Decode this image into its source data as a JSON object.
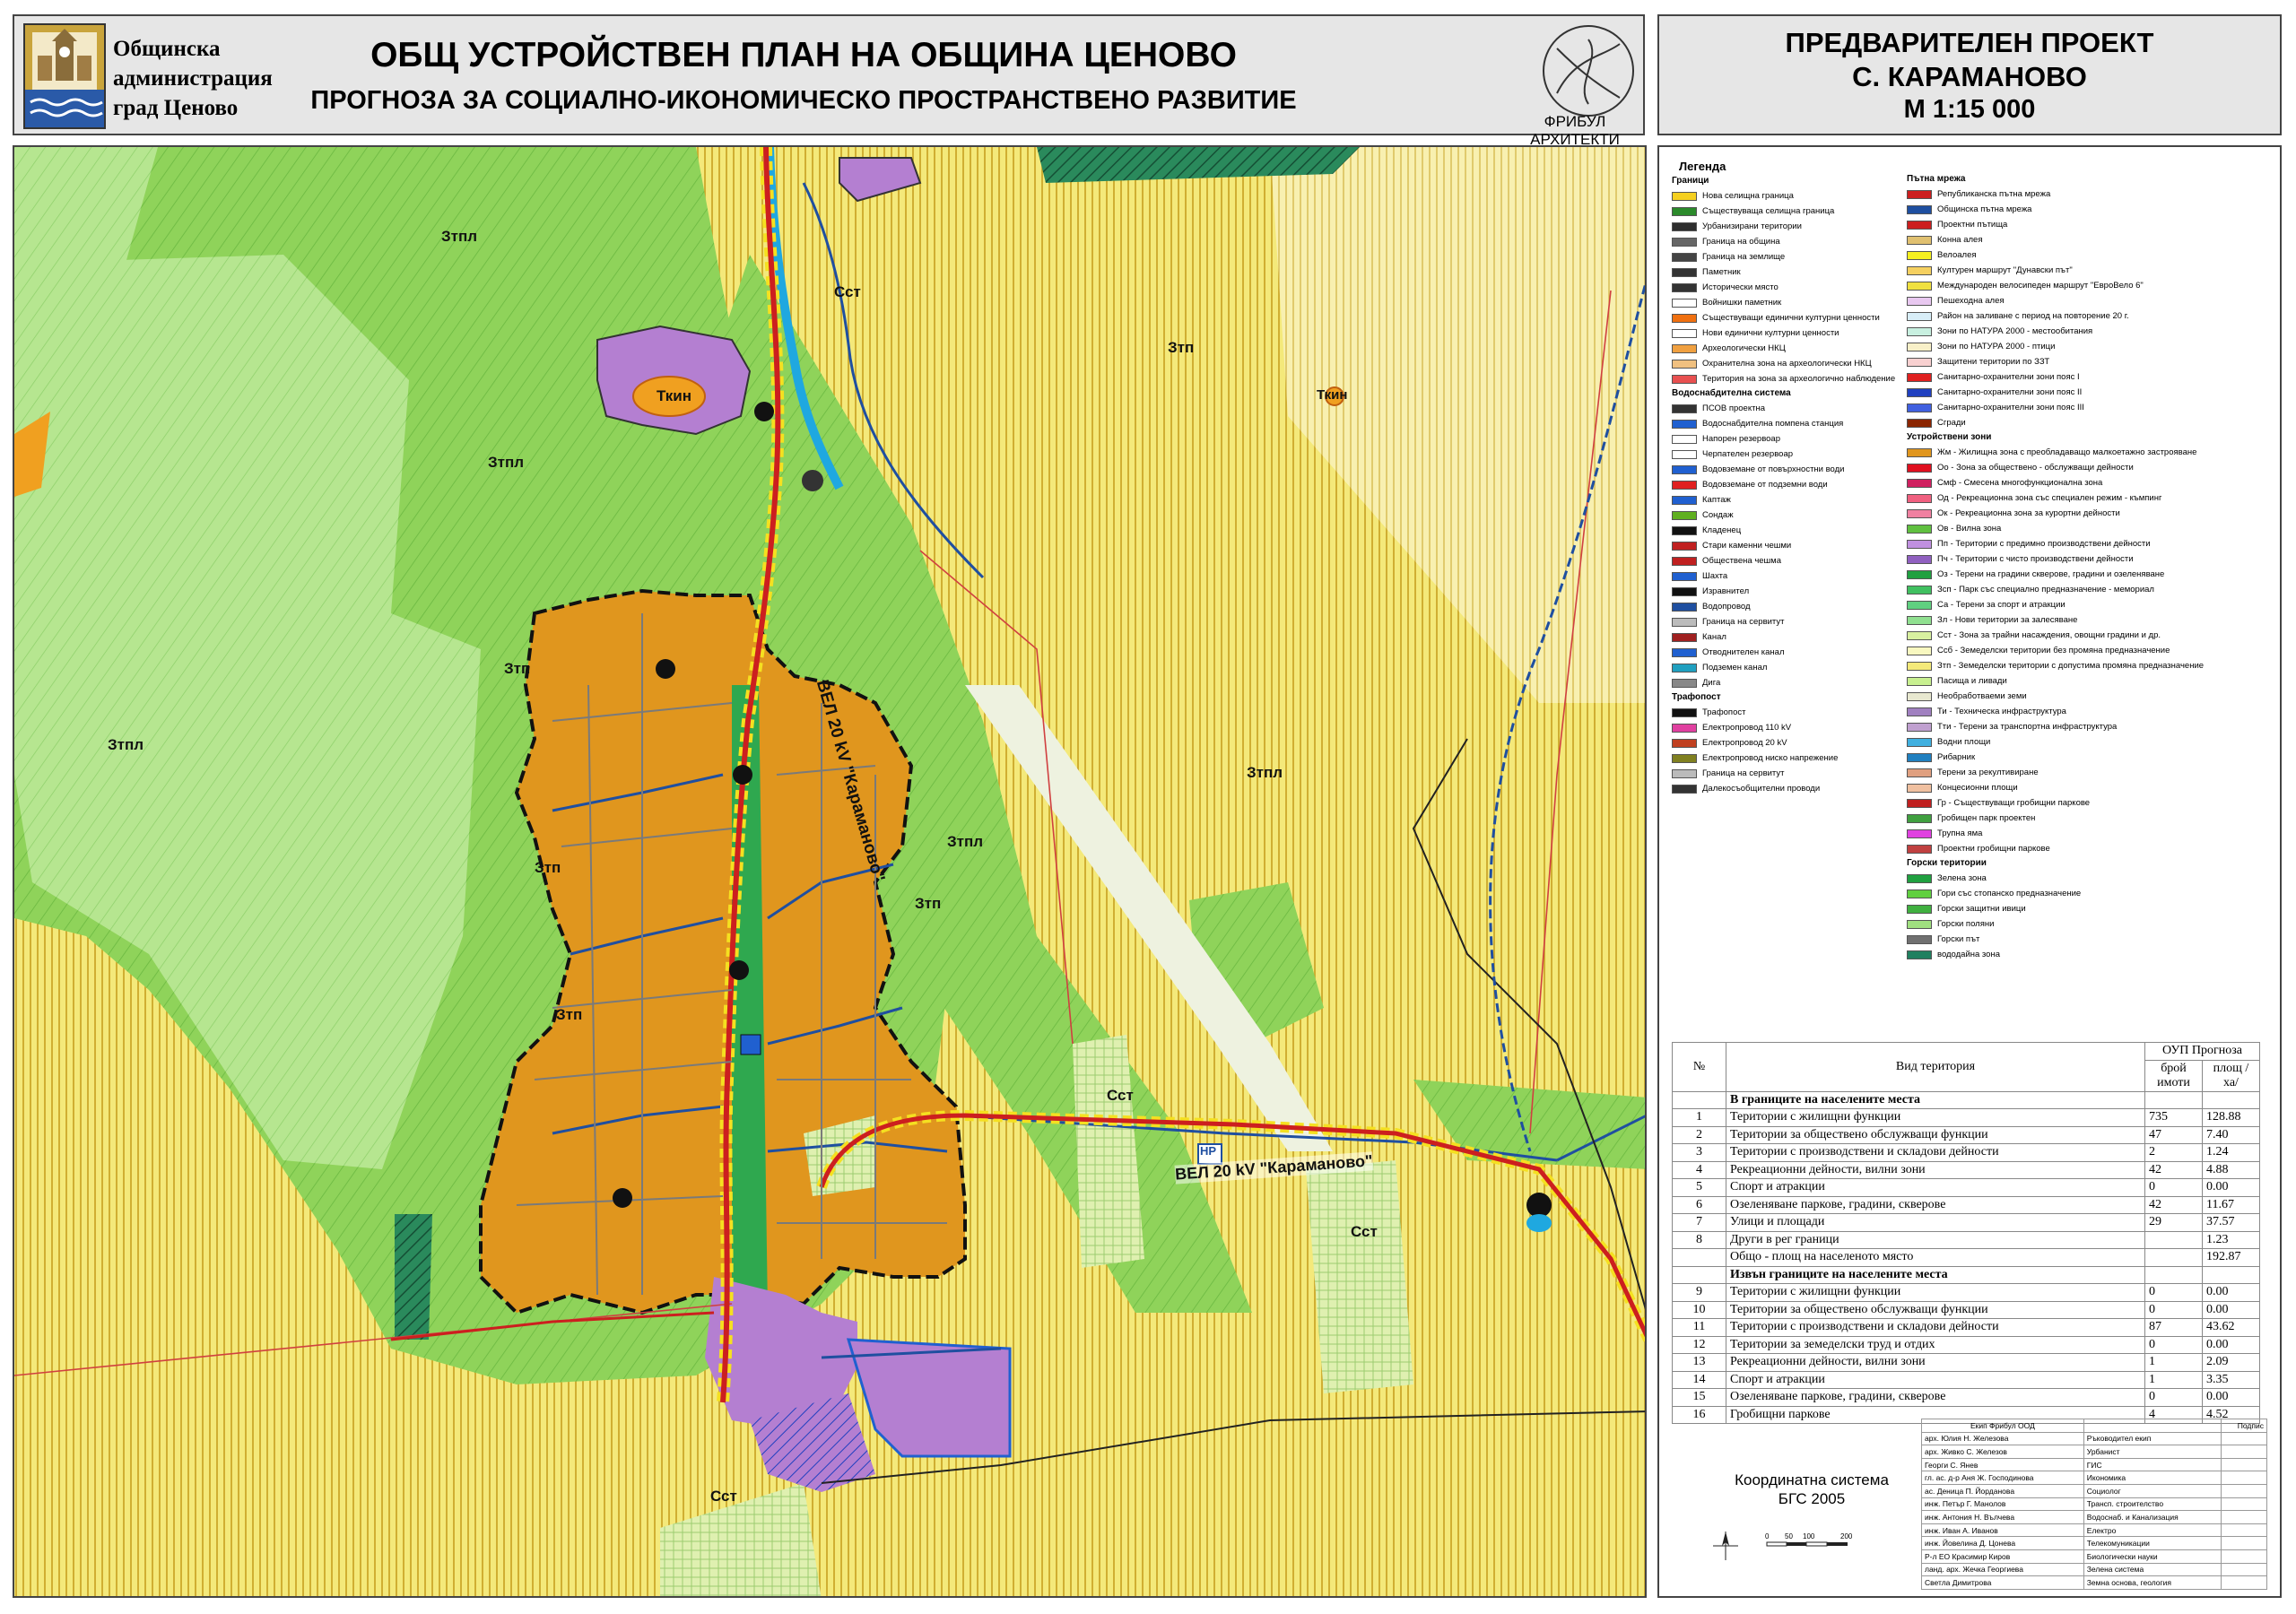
{
  "header": {
    "municipality": [
      "Общинска",
      "администрация",
      "град Ценово"
    ],
    "title_line1": "ОБЩ УСТРОЙСТВЕН ПЛАН НА ОБЩИНА ЦЕНОВО",
    "title_line2": "ПРОГНОЗА ЗА СОЦИАЛНО-ИКОНОМИЧЕСКО ПРОСТРАНСТВЕНО РАЗВИТИЕ",
    "firm": "ФРИБУЛ АРХИТЕКТИ"
  },
  "project": {
    "line1": "ПРЕДВАРИТЕЛЕН ПРОЕКТ",
    "line2": "С. КАРАМАНОВО",
    "line3": "М 1:15 000"
  },
  "colors": {
    "housing": "#e0961e",
    "agri": "#f4e97a",
    "forest_light": "#8fd35a",
    "forest": "#76c648",
    "pasture": "#b6e690",
    "industry": "#b47fd1",
    "road_rep": "#cc1f1f",
    "water": "#1fa8e0",
    "blue_net": "#1f4fa0"
  },
  "map_labels": {
    "ztpl_1": "Зтпл",
    "ztpl_2": "Зтпл",
    "ztpl_3": "Зтпл",
    "ztpl_4": "Зтпл",
    "ztpl_5": "Зтпл",
    "ztp_1": "Зтп",
    "ztp_2": "Зтп",
    "ztp_3": "Зтп",
    "ztp_4": "Зтп",
    "ztp_5": "Зтп",
    "sst_1": "Сст",
    "sst_2": "Сст",
    "sst_3": "Сст",
    "sst_4": "Сст",
    "tkin_1": "Ткин",
    "tkin_2": "Ткин",
    "line_label": "ВЕЛ 20 kV \"Караманово\"",
    "nr": "НР"
  },
  "legend": {
    "title": "Легенда",
    "col1": [
      {
        "sec": "Граници"
      },
      {
        "label": "Нова селищна граница",
        "color": "#f5d020"
      },
      {
        "label": "Съществуваща селищна граница",
        "color": "#2b8a2b"
      },
      {
        "label": "Урбанизирани територии",
        "color": "#2e2e2e"
      },
      {
        "label": "Граница на община",
        "color": "#666666"
      },
      {
        "label": "Граница на землище",
        "color": "#444444"
      },
      {
        "label": "Паметник",
        "color": "#333333"
      },
      {
        "label": "Исторически място",
        "color": "#333333"
      },
      {
        "label": "Войнишки паметник",
        "color": "#ffffff"
      },
      {
        "label": "Съществуващи единични културни ценности",
        "color": "#f07010"
      },
      {
        "label": "Нови единични културни ценности",
        "color": "#ffffff"
      },
      {
        "label": "Археологически НКЦ",
        "color": "#f0a040"
      },
      {
        "label": "Охранителна зона на археологически НКЦ",
        "color": "#f0c080"
      },
      {
        "label": "Територия на зона за археологично наблюдение",
        "color": "#e85050"
      },
      {
        "sec": "Водоснабдителна система"
      },
      {
        "label": "ПСОВ проектна",
        "color": "#333333"
      },
      {
        "label": "Водоснабдителна помпена станция",
        "color": "#2060d0"
      },
      {
        "label": "Напорен резервоар",
        "color": "#ffffff"
      },
      {
        "label": "Черпателен резервоар",
        "color": "#ffffff"
      },
      {
        "label": "Водовземане от повърхностни води",
        "color": "#2060d0"
      },
      {
        "label": "Водовземане от подземни води",
        "color": "#e02020"
      },
      {
        "label": "Каптаж",
        "color": "#2060d0"
      },
      {
        "label": "Сондаж",
        "color": "#60b020"
      },
      {
        "label": "Кладенец",
        "color": "#111111"
      },
      {
        "label": "Стари каменни чешми",
        "color": "#c02020"
      },
      {
        "label": "Обществена чешма",
        "color": "#c02020"
      },
      {
        "label": "Шахта",
        "color": "#2060d0"
      },
      {
        "label": "Изравнител",
        "color": "#111111"
      },
      {
        "label": "Водопровод",
        "color": "#1f4fa0"
      },
      {
        "label": "Граница на сервитут",
        "color": "#bbbbbb"
      },
      {
        "label": "Канал",
        "color": "#a02020"
      },
      {
        "label": "Отводнителен канал",
        "color": "#2060d0"
      },
      {
        "label": "Подземен канал",
        "color": "#20a0c0"
      },
      {
        "label": "Дига",
        "color": "#888888"
      },
      {
        "sec": "Трафопост"
      },
      {
        "label": "Трафопост",
        "color": "#111111"
      },
      {
        "label": "Електропровод 110 kV",
        "color": "#e040a0"
      },
      {
        "label": "Електропровод 20 kV",
        "color": "#c04020"
      },
      {
        "label": "Електропровод ниско напрежение",
        "color": "#808020"
      },
      {
        "label": "Граница на сервитут",
        "color": "#bbbbbb"
      },
      {
        "label": "Далекосъобщителни проводи",
        "color": "#333333"
      }
    ],
    "col2": [
      {
        "sec": "Пътна мрежа"
      },
      {
        "label": "Републиканска пътна мрежа",
        "color": "#cc1f1f"
      },
      {
        "label": "Общинска пътна мрежа",
        "color": "#1f4fa0"
      },
      {
        "label": "Проектни пътища",
        "color": "#cc1f1f"
      },
      {
        "label": "Конна алея",
        "color": "#e0c070"
      },
      {
        "label": "Велоалея",
        "color": "#f5f020"
      },
      {
        "label": "Културен маршрут \"Дунавски път\"",
        "color": "#f5d060"
      },
      {
        "label": "Международен велосипеден маршрут \"ЕвроВело 6\"",
        "color": "#f0e040"
      },
      {
        "label": "Пешеходна алея",
        "color": "#e8c8f0"
      },
      {
        "label": "Район на заливане с период на повторение 20 г.",
        "color": "#d8eef8"
      },
      {
        "label": "Зони по НАТУРА 2000 - местообитания",
        "color": "#c8f0e0"
      },
      {
        "label": "Зони по НАТУРА 2000 - птици",
        "color": "#f8f0c8"
      },
      {
        "label": "Защитени територии по ЗЗТ",
        "color": "#f8d0d0"
      },
      {
        "label": "Санитарно-охранителни зони пояс I",
        "color": "#e02020"
      },
      {
        "label": "Санитарно-охранителни зони пояс II",
        "color": "#2040c0"
      },
      {
        "label": "Санитарно-охранителни зони пояс III",
        "color": "#4060e0"
      },
      {
        "label": "Сгради",
        "color": "#8b2500"
      },
      {
        "sec": "Устройствени зони"
      },
      {
        "label": "Жм - Жилищна зона с преобладаващо малкоетажно застрояване",
        "color": "#e0961e"
      },
      {
        "label": "Оо - Зона за обществено - обслужващи дейности",
        "color": "#e01020"
      },
      {
        "label": "Смф - Смесена многофункционална зона",
        "color": "#d02060"
      },
      {
        "label": "Од - Рекреационна зона със специален режим - къмпинг",
        "color": "#f06080"
      },
      {
        "label": "Ок - Рекреационна зона за курортни дейности",
        "color": "#f080a0"
      },
      {
        "label": "Ов - Вилна зона",
        "color": "#60c040"
      },
      {
        "label": "Пп - Територии с предимно производствени дейности",
        "color": "#c090e0"
      },
      {
        "label": "Пч - Територии с чисто производствени дейности",
        "color": "#9060c0"
      },
      {
        "label": "Оз - Терени на градини скверове, градини и озеленяване",
        "color": "#20a040"
      },
      {
        "label": "Зсп - Парк със специално предназначение - мемориал",
        "color": "#40c060"
      },
      {
        "label": "Са - Терени за спорт и атракции",
        "color": "#60d080"
      },
      {
        "label": "Зл - Нови територии за залесяване",
        "color": "#90e090"
      },
      {
        "label": "Сст - Зона за трайни насаждения, овощни градини и др.",
        "color": "#d8f0a0"
      },
      {
        "label": "Ссб - Земеделски територии без промяна предназначение",
        "color": "#f8f8c0"
      },
      {
        "label": "Зтп - Земеделски територии с допустима промяна предназначение",
        "color": "#f4e97a"
      },
      {
        "label": "Пасища и ливади",
        "color": "#c8f090"
      },
      {
        "label": "Необработваеми земи",
        "color": "#e8e8d0"
      },
      {
        "label": "Ти - Техническа инфраструктура",
        "color": "#a080c0"
      },
      {
        "label": "Тти - Терени за транспортна инфраструктура",
        "color": "#c0a0d0"
      },
      {
        "label": "Водни площи",
        "color": "#40b0e0"
      },
      {
        "label": "Рибарник",
        "color": "#2080c0"
      },
      {
        "label": "Терени за рекултивиране",
        "color": "#e0a080"
      },
      {
        "label": "Концесионни площи",
        "color": "#f0c0a0"
      },
      {
        "label": "Гр - Съществуващи гробищни паркове",
        "color": "#c02020"
      },
      {
        "label": "Гробищен парк проектен",
        "color": "#40a040"
      },
      {
        "label": "Трупна яма",
        "color": "#e040e0"
      },
      {
        "label": "Проектни гробищни паркове",
        "color": "#c04040"
      },
      {
        "sec": "Горски територии"
      },
      {
        "label": "Зелена зона",
        "color": "#20a040"
      },
      {
        "label": "Гори със стопанско предназначение",
        "color": "#60d040"
      },
      {
        "label": "Горски защитни ивици",
        "color": "#40b040"
      },
      {
        "label": "Горски поляни",
        "color": "#a0e080"
      },
      {
        "label": "Горски път",
        "color": "#707070"
      },
      {
        "label": "вододайна зона",
        "color": "#208060"
      }
    ]
  },
  "area_table": {
    "headers": {
      "no": "№",
      "type": "Вид територия",
      "group": "ОУП Прогноза",
      "count": "брой имоти",
      "area": "площ /ха/"
    },
    "section1": "В границите на населените места",
    "rows1": [
      {
        "no": "1",
        "name": "Територии с жилищни функции",
        "count": "735",
        "area": "128.88"
      },
      {
        "no": "2",
        "name": "Територии за обществено обслужващи функции",
        "count": "47",
        "area": "7.40"
      },
      {
        "no": "3",
        "name": "Територии с производствени и складови дейности",
        "count": "2",
        "area": "1.24"
      },
      {
        "no": "4",
        "name": "Рекреационни дейности, вилни зони",
        "count": "42",
        "area": "4.88"
      },
      {
        "no": "5",
        "name": "Спорт и атракции",
        "count": "0",
        "area": "0.00"
      },
      {
        "no": "6",
        "name": "Озеленяване паркове, градини, скверове",
        "count": "42",
        "area": "11.67"
      },
      {
        "no": "7",
        "name": "Улици и площади",
        "count": "29",
        "area": "37.57"
      },
      {
        "no": "8",
        "name": "Други в рег граници",
        "count": "",
        "area": "1.23"
      },
      {
        "no": "",
        "name": "Общо - площ на населеното място",
        "count": "",
        "area": "192.87"
      }
    ],
    "section2": "Извън границите на населените места",
    "rows2": [
      {
        "no": "9",
        "name": "Територии с жилищни функции",
        "count": "0",
        "area": "0.00"
      },
      {
        "no": "10",
        "name": "Територии за обществено обслужващи функции",
        "count": "0",
        "area": "0.00"
      },
      {
        "no": "11",
        "name": "Територии с производствени и складови дейности",
        "count": "87",
        "area": "43.62"
      },
      {
        "no": "12",
        "name": "Територии за земеделски труд и отдих",
        "count": "0",
        "area": "0.00"
      },
      {
        "no": "13",
        "name": "Рекреационни дейности, вилни зони",
        "count": "1",
        "area": "2.09"
      },
      {
        "no": "14",
        "name": "Спорт и атракции",
        "count": "1",
        "area": "3.35"
      },
      {
        "no": "15",
        "name": "Озеленяване паркове, градини, скверове",
        "count": "0",
        "area": "0.00"
      },
      {
        "no": "16",
        "name": "Гробищни паркове",
        "count": "4",
        "area": "4.52"
      }
    ]
  },
  "coord_system": [
    "Координатна система",
    "БГС 2005"
  ],
  "scale_bar": [
    "0",
    "50",
    "100",
    "200"
  ],
  "team": {
    "header": "Екип Фрибул ООД",
    "sign": "Подпис",
    "rows": [
      {
        "name": "арх. Юлия Н. Железова",
        "role": "Ръководител екип"
      },
      {
        "name": "арх. Живко С. Железов",
        "role": "Урбанист"
      },
      {
        "name": "Георги С. Янев",
        "role": "ГИС"
      },
      {
        "name": "гл. ас. д-р Аня Ж. Господинова",
        "role": "Икономика"
      },
      {
        "name": "ас. Деница П. Йорданова",
        "role": "Социолог"
      },
      {
        "name": "инж. Петър Г. Манолов",
        "role": "Трансп. строителство"
      },
      {
        "name": "инж. Антония Н. Вълчева",
        "role": "Водоснаб. и Канализация"
      },
      {
        "name": "инж. Иван А. Иванов",
        "role": "Електро"
      },
      {
        "name": "инж. Йовелина Д. Цонева",
        "role": "Телекомуникации"
      },
      {
        "name": "Р-л ЕО Красимир Киров",
        "role": "Биологически науки"
      },
      {
        "name": "ланд. арх. Жечка Георгиева",
        "role": "Зелена система"
      },
      {
        "name": "Светла Димитрова",
        "role": "Земна основа, геология"
      }
    ]
  }
}
